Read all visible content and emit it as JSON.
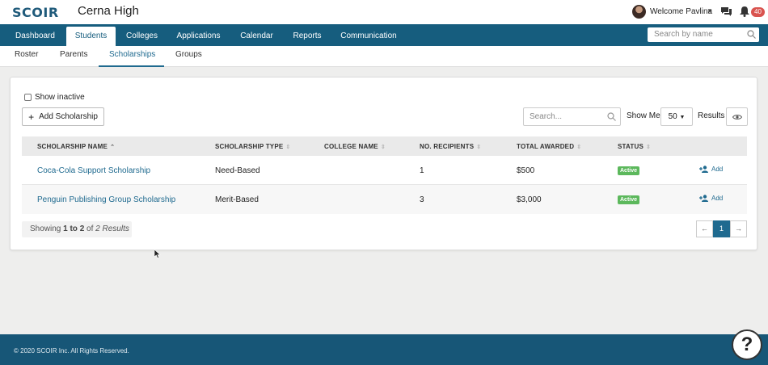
{
  "header": {
    "logo": "SCOIR",
    "school_name": "Cerna High",
    "welcome": "Welcome Pavlina",
    "notification_count": "40"
  },
  "main_nav": {
    "tabs": [
      "Dashboard",
      "Students",
      "Colleges",
      "Applications",
      "Calendar",
      "Reports",
      "Communication"
    ],
    "active": "Students",
    "search_placeholder": "Search by name"
  },
  "sub_nav": {
    "tabs": [
      "Roster",
      "Parents",
      "Scholarships",
      "Groups"
    ],
    "active": "Scholarships"
  },
  "toolbar": {
    "show_inactive_label": "Show inactive",
    "show_inactive_checked": false,
    "add_button_label": "Add Scholarship",
    "search_placeholder": "Search...",
    "show_me_label": "Show Me",
    "per_page": "50",
    "results_label": "Results"
  },
  "table": {
    "columns": [
      "SCHOLARSHIP NAME",
      "SCHOLARSHIP TYPE",
      "COLLEGE NAME",
      "NO. RECIPIENTS",
      "TOTAL AWARDED",
      "STATUS"
    ],
    "sorted_column": "SCHOLARSHIP NAME",
    "rows": [
      {
        "name": "Coca-Cola Support Scholarship",
        "type": "Need-Based",
        "college": "",
        "recipients": "1",
        "awarded": "$500",
        "status": "Active",
        "action": "Add"
      },
      {
        "name": "Penguin Publishing Group Scholarship",
        "type": "Merit-Based",
        "college": "",
        "recipients": "3",
        "awarded": "$3,000",
        "status": "Active",
        "action": "Add"
      }
    ]
  },
  "footer_info": {
    "showing_prefix": "Showing",
    "range": "1 to 2",
    "of": "of",
    "total": "2 Results"
  },
  "pagination": {
    "prev": "←",
    "current": "1",
    "next": "→"
  },
  "footer": {
    "copyright": "© 2020 SCOIR Inc. All Rights Reserved.",
    "help_symbol": "?"
  },
  "colors": {
    "nav": "#165d7e",
    "footer": "#175677",
    "link": "#1f6a8f",
    "status_active": "#5cb85c",
    "badge": "#d9534f"
  }
}
